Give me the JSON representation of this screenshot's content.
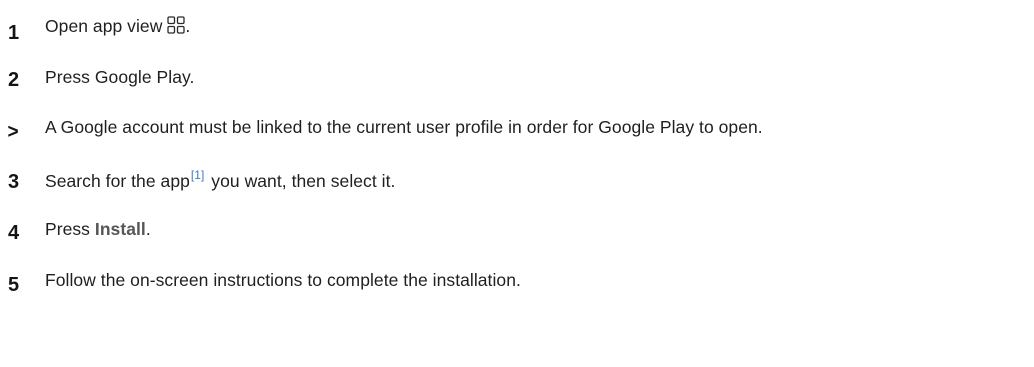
{
  "steps": [
    {
      "marker": "1",
      "text": "Open app view",
      "icon": "app-grid-icon",
      "suffix": "."
    },
    {
      "marker": "2",
      "text": "Press Google Play."
    },
    {
      "marker": ">",
      "text": "A Google account must be linked to the current user profile in order for Google Play to open."
    },
    {
      "marker": "3",
      "text_before": "Search for the app",
      "reference": "[1]",
      "text_after": " you want, then select it."
    },
    {
      "marker": "4",
      "text_before": "Press ",
      "emphasis": "Install",
      "text_after": "."
    },
    {
      "marker": "5",
      "text": "Follow the on-screen instructions to complete the installation."
    }
  ],
  "colors": {
    "text": "#1f1f1f",
    "marker": "#141414",
    "reference_link": "#3b7cc2",
    "emphasis": "#575757"
  }
}
